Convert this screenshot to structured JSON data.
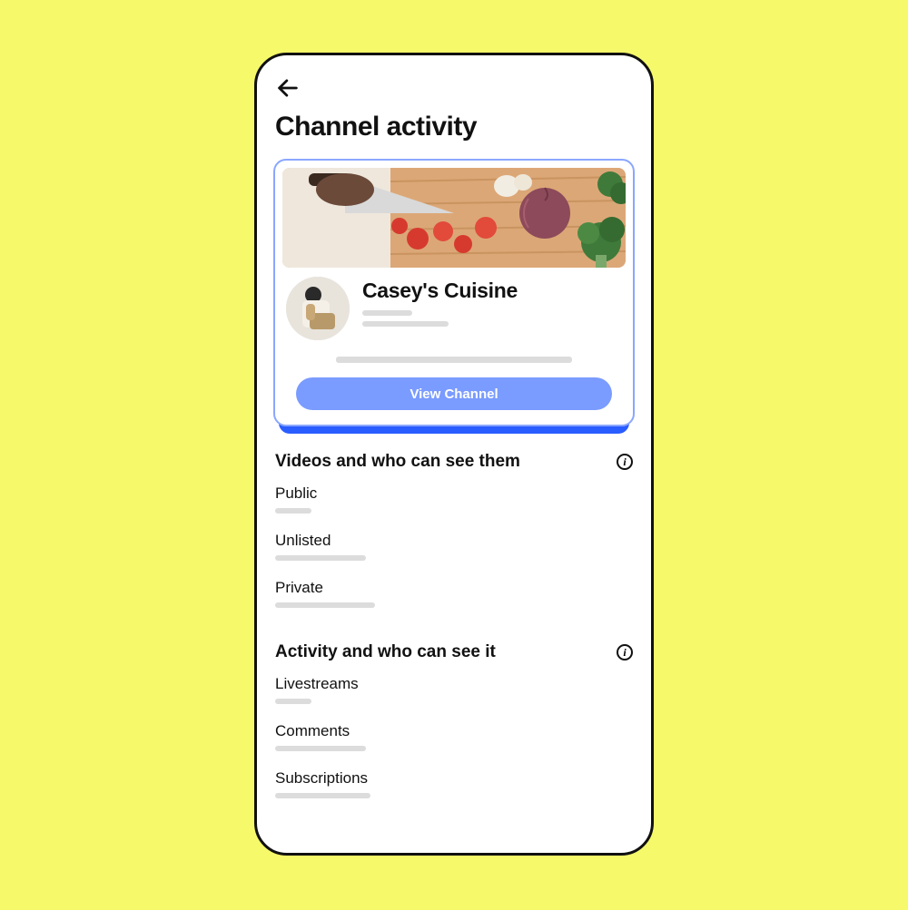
{
  "header": {
    "back_icon": "back-arrow-icon",
    "title": "Channel activity"
  },
  "channel_card": {
    "name": "Casey's Cuisine",
    "view_button_label": "View Channel"
  },
  "sections": {
    "videos": {
      "title": "Videos and who can see them",
      "items": [
        {
          "label": "Public"
        },
        {
          "label": "Unlisted"
        },
        {
          "label": "Private"
        }
      ]
    },
    "activity": {
      "title": "Activity and who can see it",
      "items": [
        {
          "label": "Livestreams"
        },
        {
          "label": "Comments"
        },
        {
          "label": "Subscriptions"
        }
      ]
    }
  },
  "colors": {
    "page_bg": "#f6f96a",
    "accent_blue": "#7a9bff",
    "accent_blue_deep": "#2a5dff",
    "card_border": "#8aa7ff",
    "skeleton": "#dcdcdc"
  }
}
